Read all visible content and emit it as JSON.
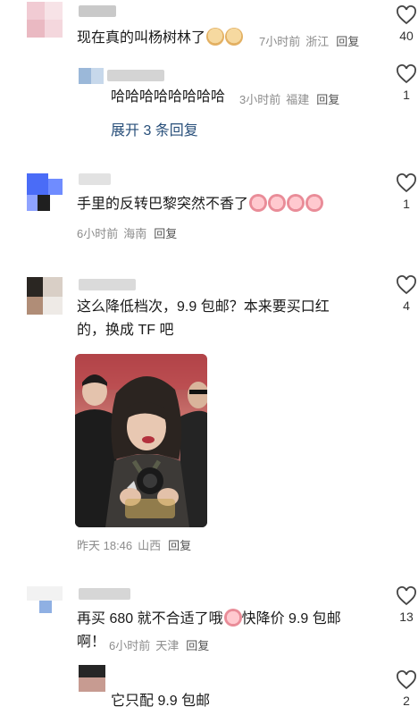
{
  "comments": [
    {
      "text": "现在真的叫杨树林了",
      "time": "7小时前",
      "location": "浙江",
      "reply": "回复",
      "likes": "40"
    },
    {
      "text": "哈哈哈哈哈哈哈哈",
      "time": "3小时前",
      "location": "福建",
      "reply": "回复",
      "likes": "1",
      "expand": "展开 3 条回复"
    },
    {
      "text": "手里的反转巴黎突然不香了",
      "time": "6小时前",
      "location": "海南",
      "reply": "回复",
      "likes": "1"
    },
    {
      "text_line1": "这么降低档次，9.9 包邮？本来要买口红",
      "text_line2": "的，换成 TF 吧",
      "time": "昨天 18:46",
      "location": "山西",
      "reply": "回复",
      "likes": "4"
    },
    {
      "text_line1_a": "再买 680 就不合适了哦",
      "text_line1_b": "快降价 9.9 包邮",
      "text_line2": "啊！",
      "time": "6小时前",
      "location": "天津",
      "reply": "回复",
      "likes": "13"
    },
    {
      "text": "它只配 9.9 包邮",
      "likes": "2"
    }
  ],
  "icons": {
    "like": "heart-outline-icon"
  }
}
